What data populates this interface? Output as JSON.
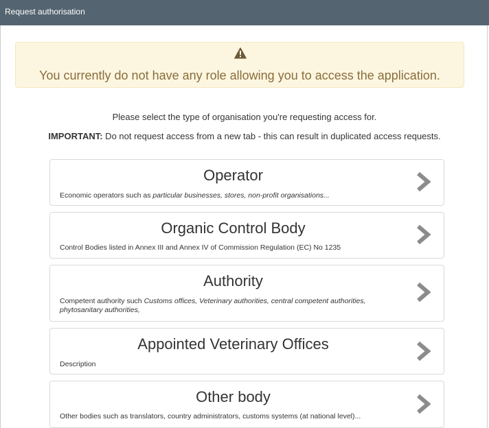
{
  "header": {
    "title": "Request authorisation"
  },
  "warning": {
    "icon": "warning-triangle-icon",
    "message": "You currently do not have any role allowing you to access the application."
  },
  "intro": {
    "line1": "Please select the type of organisation you're requesting access for.",
    "important_label": "IMPORTANT:",
    "important_text": " Do not request access from a new tab - this can result in duplicated access requests."
  },
  "options": [
    {
      "title": "Operator",
      "desc_plain": "Economic operators such as ",
      "desc_italic": "particular businesses, stores, non-profit organisations..."
    },
    {
      "title": "Organic Control Body",
      "desc_plain": "Control Bodies listed in Annex III and Annex IV of Commission Regulation (EC) No 1235",
      "desc_italic": ""
    },
    {
      "title": "Authority",
      "desc_plain": "Competent authority such ",
      "desc_italic": "Customs offices, Veterinary authorities, central competent authorities, phytosanitary authorities,"
    },
    {
      "title": "Appointed Veterinary Offices",
      "desc_plain": "Description",
      "desc_italic": ""
    },
    {
      "title": "Other body",
      "desc_plain": "Other bodies such as translators, country administrators, customs systems (at national level)...",
      "desc_italic": ""
    }
  ],
  "colors": {
    "header_bg": "#546470",
    "warning_bg": "#fcf6e1",
    "warning_text": "#8a6d3b",
    "chevron": "#8c8c8c"
  }
}
